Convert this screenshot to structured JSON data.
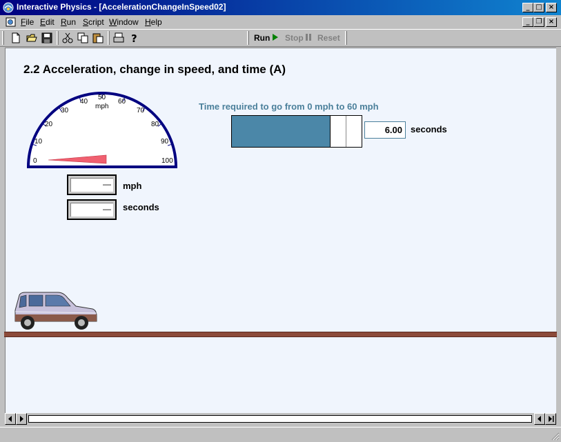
{
  "window": {
    "title": "Interactive Physics - [AccelerationChangeInSpeed02]",
    "minimize_label": "_",
    "maximize_label": "□",
    "close_label": "×"
  },
  "menu": {
    "items": [
      {
        "mnemonic": "F",
        "rest": "ile"
      },
      {
        "mnemonic": "E",
        "rest": "dit"
      },
      {
        "mnemonic": "R",
        "rest": "un"
      },
      {
        "mnemonic": "S",
        "rest": "cript"
      },
      {
        "mnemonic": "W",
        "rest": "indow"
      },
      {
        "mnemonic": "H",
        "rest": "elp"
      }
    ],
    "doc_minimize_label": "_",
    "doc_restore_label": "❐",
    "doc_close_label": "×"
  },
  "toolbar": {
    "icons": [
      "new-file-icon",
      "open-folder-icon",
      "save-disk-icon",
      "cut-scissors-icon",
      "copy-icon",
      "paste-icon",
      "print-icon",
      "help-question-icon"
    ],
    "run_label": "Run",
    "stop_label": "Stop",
    "reset_label": "Reset",
    "run_color": "#008000",
    "disabled_color": "#808080"
  },
  "page": {
    "title": "2.2 Acceleration, change in speed, and time (A)",
    "background": "#f0f5fd"
  },
  "speedometer": {
    "unit": "mph",
    "ticks": [
      "0",
      "10",
      "20",
      "30",
      "40",
      "50",
      "60",
      "70",
      "80",
      "90",
      "100"
    ],
    "min": 0,
    "max": 100,
    "needle_value": 0,
    "dial_color": "#000080",
    "needle_color": "#f06070"
  },
  "readouts": {
    "speed": {
      "value": "—",
      "unit": "mph"
    },
    "time": {
      "value": "—",
      "unit": "seconds"
    }
  },
  "time_slider": {
    "caption": "Time required to go from 0 mph to 60 mph",
    "value": "6.00",
    "unit": "seconds",
    "fill_fraction": 0.76,
    "fill_color": "#4b87a8"
  },
  "scene": {
    "ground_color": "#8c4b3a",
    "car_body_color": "#c8c2dc"
  }
}
